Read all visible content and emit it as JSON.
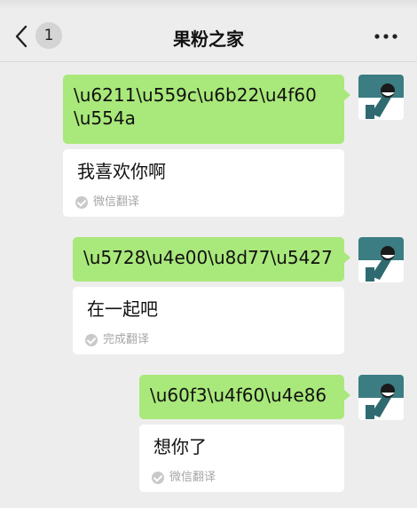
{
  "nav": {
    "unread_count": "1",
    "title": "果粉之家"
  },
  "icons": {
    "back": "chevron-left-icon",
    "more": "more-dots-icon",
    "check": "check-circle-icon"
  },
  "colors": {
    "background": "#ededed",
    "sent_bubble": "#a9e87a",
    "translation_bubble": "#ffffff",
    "status_text": "#a6a6a6"
  },
  "messages": [
    {
      "text": "\\u6211\\u559c\\u6b22\\u4f60\\u554a",
      "translation": "我喜欢你啊",
      "translation_status": "微信翻译"
    },
    {
      "text": "\\u5728\\u4e00\\u8d77\\u5427",
      "translation": "在一起吧",
      "translation_status": "完成翻译"
    },
    {
      "text": "\\u60f3\\u4f60\\u4e86",
      "translation": "想你了",
      "translation_status": "微信翻译"
    }
  ]
}
